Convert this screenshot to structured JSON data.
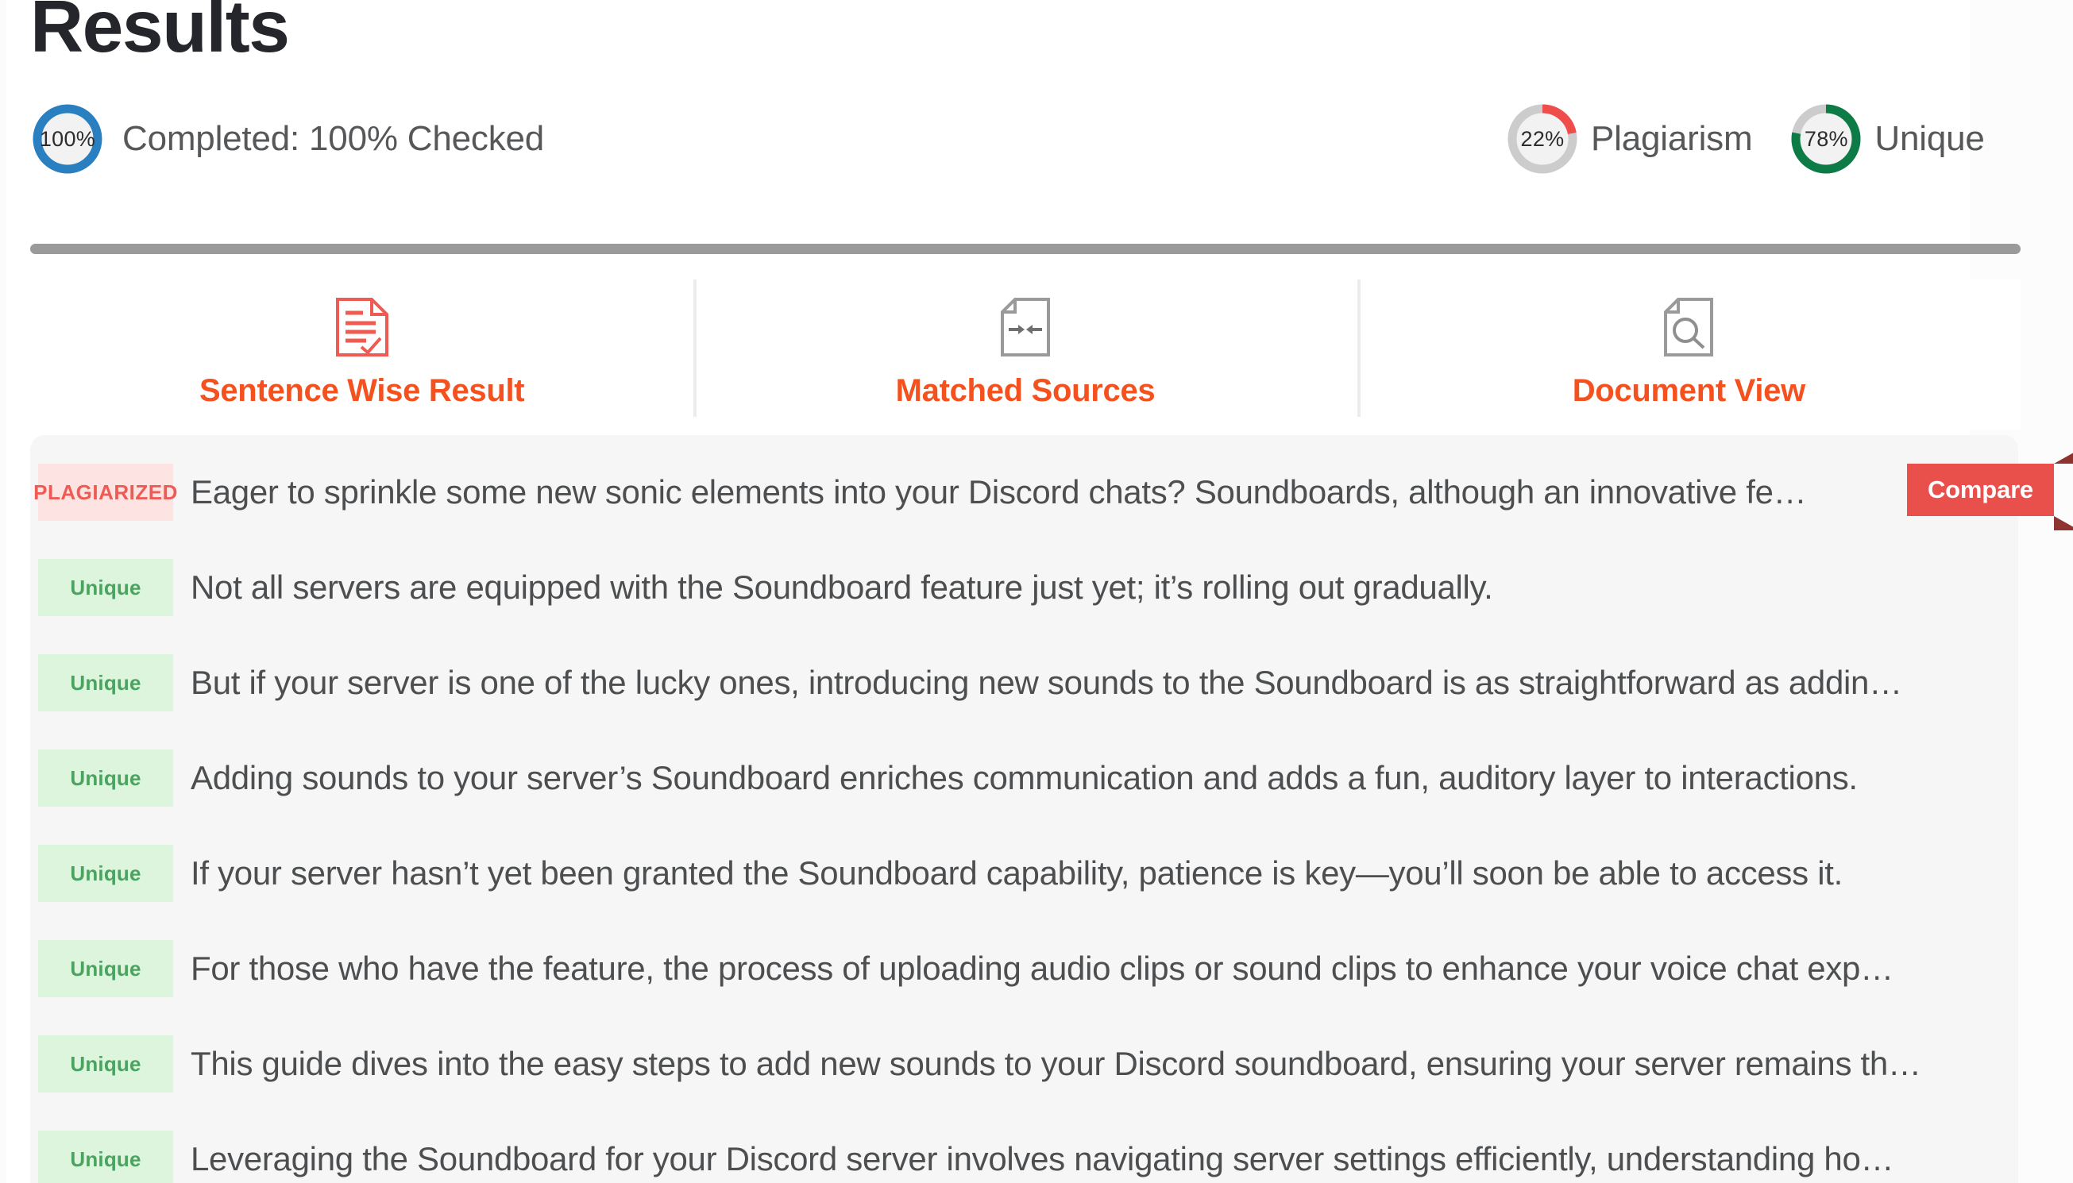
{
  "header": {
    "title": "Results",
    "completion": {
      "percent_label": "100%",
      "percent_value": 100,
      "text": "Completed: 100% Checked",
      "color": "#2a7fc1"
    },
    "gauges": [
      {
        "percent_label": "22%",
        "percent_value": 22,
        "caption": "Plagiarism",
        "color": "#ef4c4c",
        "track_color": "#cccccc"
      },
      {
        "percent_label": "78%",
        "percent_value": 78,
        "caption": "Unique",
        "color": "#0c7b45",
        "track_color": "#cccccc"
      }
    ]
  },
  "tabs": [
    {
      "label": "Sentence Wise Result",
      "icon": "document-check-icon",
      "active": true,
      "icon_color": "#ef5a52"
    },
    {
      "label": "Matched Sources",
      "icon": "document-arrows-icon",
      "active": false,
      "icon_color": "#9a9a9a"
    },
    {
      "label": "Document View",
      "icon": "document-search-icon",
      "active": false,
      "icon_color": "#9a9a9a"
    }
  ],
  "colors": {
    "accent": "#f4511e",
    "plagiarized_text": "#ee5b55",
    "plagiarized_bg": "#fde3e1",
    "unique_text": "#4aa35f",
    "unique_bg": "#ddf5dd",
    "panel_bg": "#f6f6f6",
    "compare_bg": "#e94f4b",
    "compare_fold": "#8e3330",
    "sentence_text": "#4c4e50",
    "divider": "#9a9a9a"
  },
  "compare_button": {
    "label": "Compare"
  },
  "results": [
    {
      "status": "PLAGIARIZED",
      "status_kind": "plag",
      "text": "Eager to sprinkle some new sonic elements into your Discord chats? Soundboards, although an innovative fe…",
      "has_compare": true
    },
    {
      "status": "Unique",
      "status_kind": "uniq",
      "text": "Not all servers are equipped with the Soundboard feature just yet; it’s rolling out gradually.",
      "has_compare": false
    },
    {
      "status": "Unique",
      "status_kind": "uniq",
      "text": "But if your server is one of the lucky ones, introducing new sounds to the Soundboard is as straightforward as addin…",
      "has_compare": false
    },
    {
      "status": "Unique",
      "status_kind": "uniq",
      "text": "Adding sounds to your server’s Soundboard enriches communication and adds a fun, auditory layer to interactions.",
      "has_compare": false
    },
    {
      "status": "Unique",
      "status_kind": "uniq",
      "text": "If your server hasn’t yet been granted the Soundboard capability, patience is key—you’ll soon be able to access it.",
      "has_compare": false
    },
    {
      "status": "Unique",
      "status_kind": "uniq",
      "text": "For those who have the feature, the process of uploading audio clips or sound clips to enhance your voice chat exp…",
      "has_compare": false
    },
    {
      "status": "Unique",
      "status_kind": "uniq",
      "text": "This guide dives into the easy steps to add new sounds to your Discord soundboard, ensuring your server remains th…",
      "has_compare": false
    },
    {
      "status": "Unique",
      "status_kind": "uniq",
      "text": "Leveraging the Soundboard for your Discord server involves navigating server settings efficiently, understanding ho…",
      "has_compare": false
    }
  ]
}
